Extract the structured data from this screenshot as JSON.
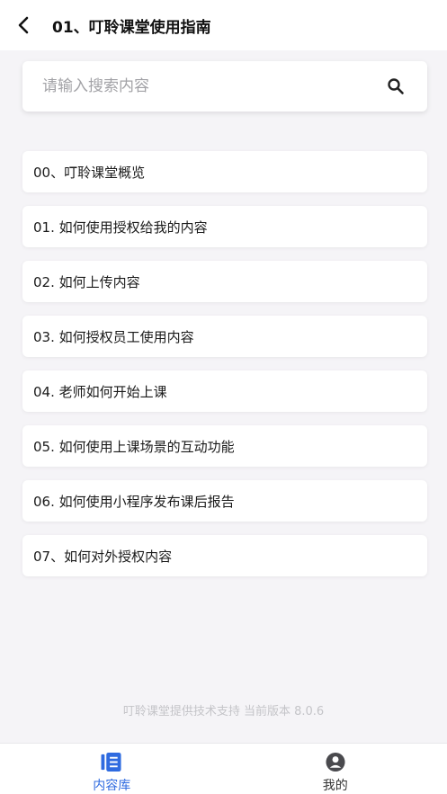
{
  "header": {
    "back_icon": "chevron-left-icon",
    "title": "01、叮聆课堂使用指南"
  },
  "search": {
    "placeholder": "请输入搜索内容",
    "value": "",
    "icon": "search-icon"
  },
  "items": [
    {
      "label": "00、叮聆课堂概览"
    },
    {
      "label": "01. 如何使用授权给我的内容"
    },
    {
      "label": "02. 如何上传内容"
    },
    {
      "label": "03. 如何授权员工使用内容"
    },
    {
      "label": "04. 老师如何开始上课"
    },
    {
      "label": "05. 如何使用上课场景的互动功能"
    },
    {
      "label": "06. 如何使用小程序发布课后报告"
    },
    {
      "label": "07、如何对外授权内容"
    }
  ],
  "footer": {
    "note": "叮聆课堂提供技术支持 当前版本 8.0.6"
  },
  "tabbar": {
    "tabs": [
      {
        "label": "内容库",
        "icon": "content-library-icon",
        "active": true
      },
      {
        "label": "我的",
        "icon": "user-profile-icon",
        "active": false
      }
    ]
  },
  "colors": {
    "accent": "#2f6be0",
    "background": "#f5f4f7",
    "footer_text": "#c4c4c8"
  }
}
